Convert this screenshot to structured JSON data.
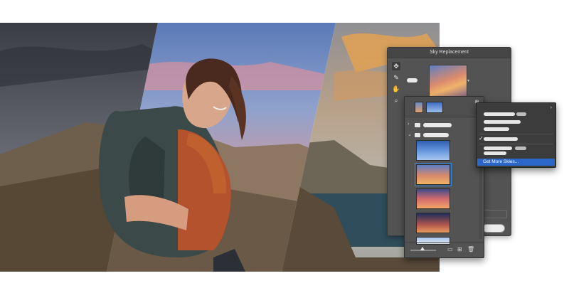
{
  "dialog": {
    "title": "Sky Replacement",
    "tools": [
      "move-icon",
      "brush-icon",
      "hand-icon",
      "zoom-icon"
    ]
  },
  "picker": {
    "groups": [
      "collapsed",
      "expanded"
    ]
  },
  "menu": {
    "checked_item_index": 3,
    "get_more_label": "Get More Skies..."
  },
  "colors": {
    "menu_highlight": "#2a67c9",
    "panel_bg": "#535353",
    "menu_bg": "#3c3c3c"
  }
}
